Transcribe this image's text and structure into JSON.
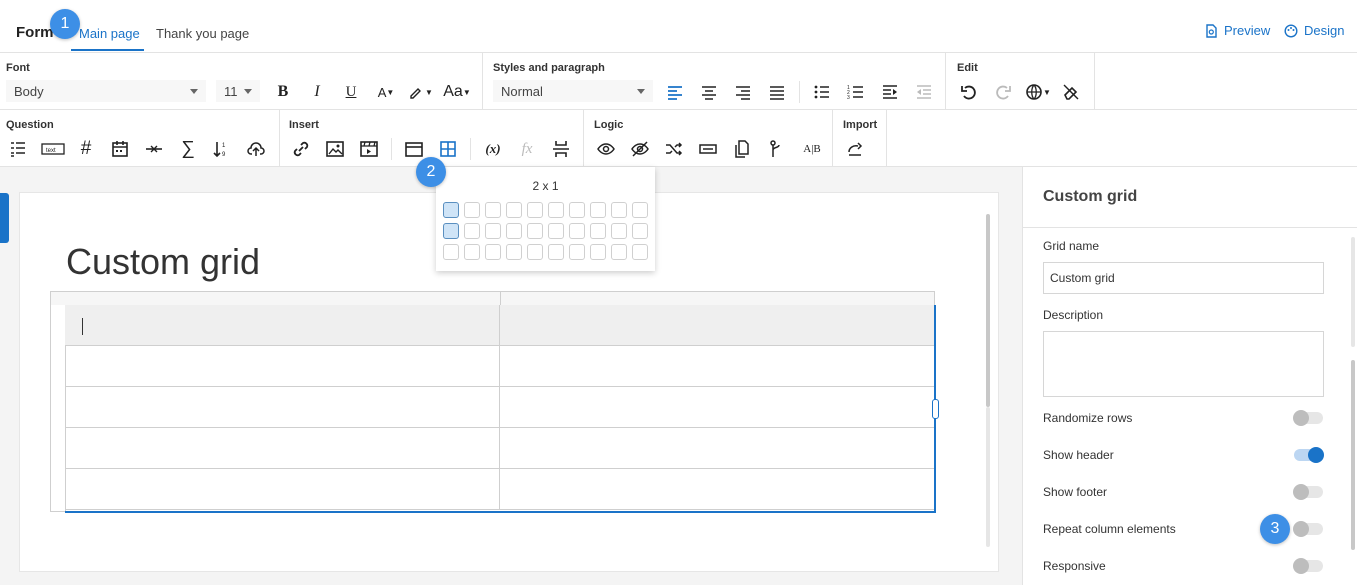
{
  "header": {
    "form_label": "Form",
    "tabs": [
      {
        "label": "Main page",
        "active": true
      },
      {
        "label": "Thank you page",
        "active": false
      }
    ],
    "actions": [
      {
        "label": "Preview",
        "icon": "preview-icon"
      },
      {
        "label": "Design",
        "icon": "palette-icon"
      }
    ]
  },
  "badges": [
    "1",
    "2",
    "3"
  ],
  "ribbon": {
    "font": {
      "label": "Font",
      "style_value": "Body",
      "size_value": "11",
      "bold": "B",
      "italic": "I",
      "underline": "U",
      "font_color": "A",
      "case": "Aa"
    },
    "styles": {
      "label": "Styles and paragraph",
      "value": "Normal"
    },
    "edit": {
      "label": "Edit"
    },
    "question": {
      "label": "Question"
    },
    "insert": {
      "label": "Insert"
    },
    "logic": {
      "label": "Logic",
      "split_text": "A|B"
    },
    "import": {
      "label": "Import"
    }
  },
  "table_picker": {
    "size_label": "2 x 1",
    "rows": 3,
    "cols": 10,
    "selected_rows": 2,
    "selected_cols": 1
  },
  "canvas": {
    "grid_title": "Custom grid",
    "grid_rows": 5,
    "grid_cols": 2
  },
  "panel": {
    "title": "Custom grid",
    "grid_name_label": "Grid name",
    "grid_name_value": "Custom grid",
    "description_label": "Description",
    "description_value": "",
    "toggles": [
      {
        "label": "Randomize rows",
        "on": false
      },
      {
        "label": "Show header",
        "on": true
      },
      {
        "label": "Show footer",
        "on": false
      },
      {
        "label": "Repeat column elements",
        "on": false
      },
      {
        "label": "Responsive",
        "on": false
      }
    ]
  },
  "colors": {
    "accent": "#1a73c8",
    "badge": "#3d8fe6"
  }
}
